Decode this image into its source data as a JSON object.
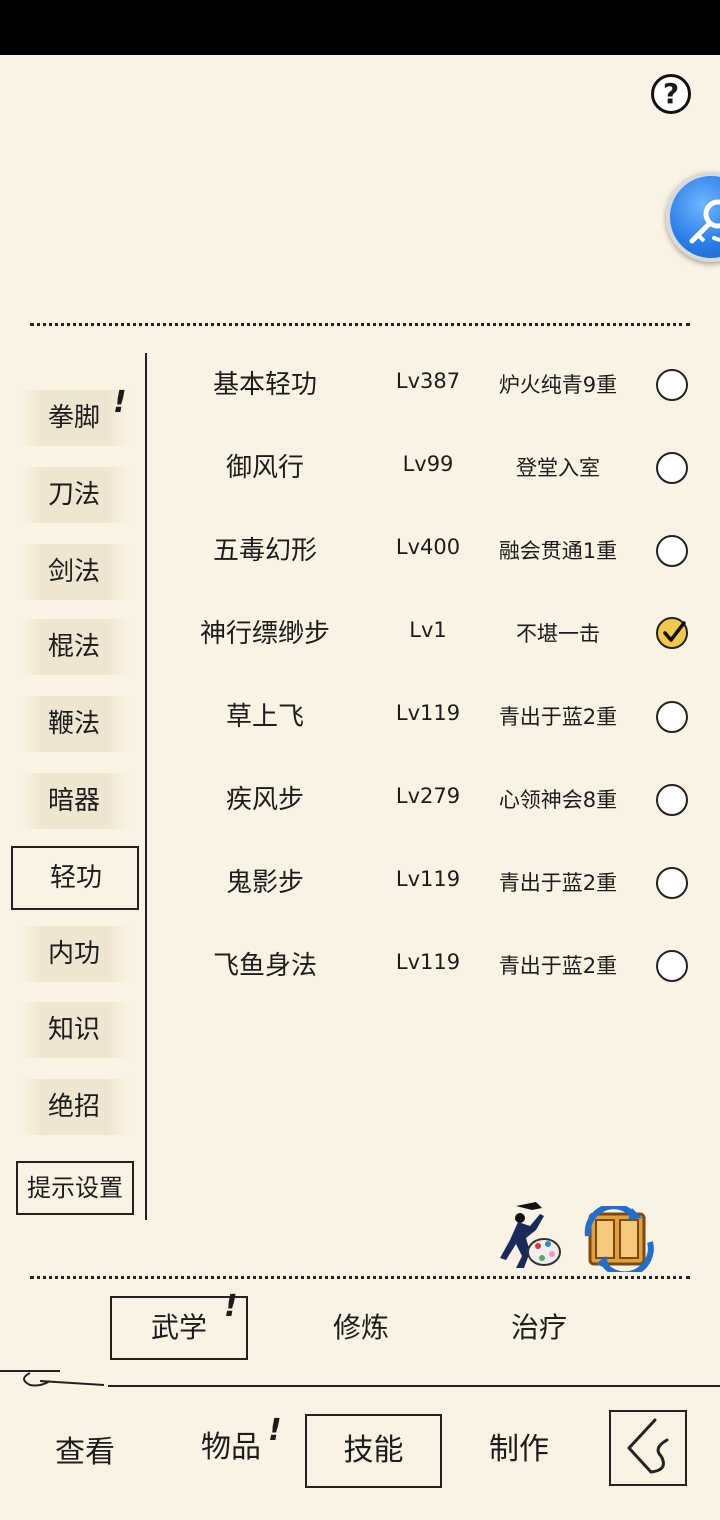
{
  "header": {
    "help_icon": "question-circle-icon",
    "float_icon": "search-key-icon"
  },
  "categories": [
    {
      "label": "拳脚",
      "alert": "!"
    },
    {
      "label": "刀法"
    },
    {
      "label": "剑法"
    },
    {
      "label": "棍法"
    },
    {
      "label": "鞭法"
    },
    {
      "label": "暗器"
    },
    {
      "label": "轻功",
      "active": true
    },
    {
      "label": "内功"
    },
    {
      "label": "知识"
    },
    {
      "label": "绝招"
    }
  ],
  "hint_settings_label": "提示设置",
  "skills": [
    {
      "name": "基本轻功",
      "level": "Lv387",
      "rank": "炉火纯青9重",
      "selected": false
    },
    {
      "name": "御风行",
      "level": "Lv99",
      "rank": "登堂入室",
      "selected": false
    },
    {
      "name": "五毒幻形",
      "level": "Lv400",
      "rank": "融会贯通1重",
      "selected": false
    },
    {
      "name": "神行缥缈步",
      "level": "Lv1",
      "rank": "不堪一击",
      "selected": true
    },
    {
      "name": "草上飞",
      "level": "Lv119",
      "rank": "青出于蓝2重",
      "selected": false
    },
    {
      "name": "疾风步",
      "level": "Lv279",
      "rank": "心领神会8重",
      "selected": false
    },
    {
      "name": "鬼影步",
      "level": "Lv119",
      "rank": "青出于蓝2重",
      "selected": false
    },
    {
      "name": "飞鱼身法",
      "level": "Lv119",
      "rank": "青出于蓝2重",
      "selected": false
    }
  ],
  "action_icons": [
    "fighter-palette-icon",
    "book-swap-icon"
  ],
  "sub_tabs": [
    {
      "label": "武学",
      "alert": "!",
      "active": true
    },
    {
      "label": "修炼"
    },
    {
      "label": "治疗"
    }
  ],
  "bottom_nav": [
    {
      "label": "查看"
    },
    {
      "label": "物品",
      "alert": "!"
    },
    {
      "label": "技能",
      "active": true
    },
    {
      "label": "制作"
    }
  ],
  "back_icon": "back-arrow-icon"
}
